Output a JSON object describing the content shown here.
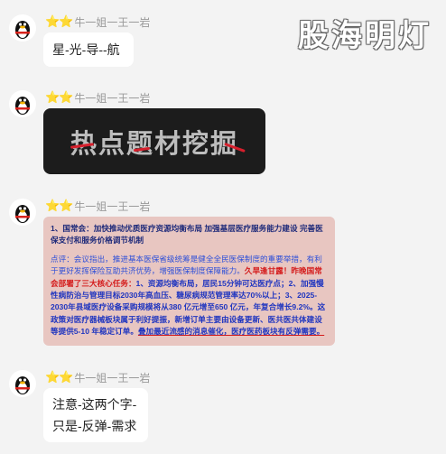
{
  "watermark": "股海明灯",
  "messages": [
    {
      "stars": "⭐⭐",
      "sender": "牛一姐一王一岩",
      "text": "星-光-导--航"
    },
    {
      "stars": "⭐⭐",
      "sender": "牛一姐一王一岩",
      "image_title": "热点题材挖掘"
    },
    {
      "stars": "⭐⭐",
      "sender": "牛一姐一王一岩",
      "news": {
        "title": "1、国常会：加快推动优质医疗资源均衡布局 加强基层医疗服务能力建设 完善医保支付和服务价格调节机制",
        "comment_label": "点评：",
        "comment_intro": "会议指出，推进基本医保省级统筹是健全全民医保制度的重要举措，有利于更好发挥保险互助共济优势，增强医保制度保障能力。",
        "red_text": "久旱逢甘露！昨晚国常会部署了三大核心任务：",
        "highlight_text": "1、资源均衡布局，居民15分钟可达医疗点；2、加强慢性病防治与管理目标2030年高血压、糖尿病规范管理率达70%以上；3、2025-2030年县域医疗设备采购规模将从380 亿元增至650 亿元，年复合增长9.2%。这政策对医疗器械板块属于利好提振，新增订单主要由设备更新、医共医共体建设等提供5-10 年稳定订单。",
        "conclusion": "叠加最近流感的消息催化，医疗医药板块有反弹需要。"
      }
    },
    {
      "stars": "⭐⭐",
      "sender": "牛一姐一王一岩",
      "lines": [
        "注意-这两个字-",
        "只是-反弹-需求"
      ]
    }
  ],
  "colors": {
    "background": "#f3f3f3",
    "star": "#f5b301",
    "news_bg": "#e8c6c1",
    "news_text": "#2f50d8",
    "alert_red": "#d41b1b"
  }
}
